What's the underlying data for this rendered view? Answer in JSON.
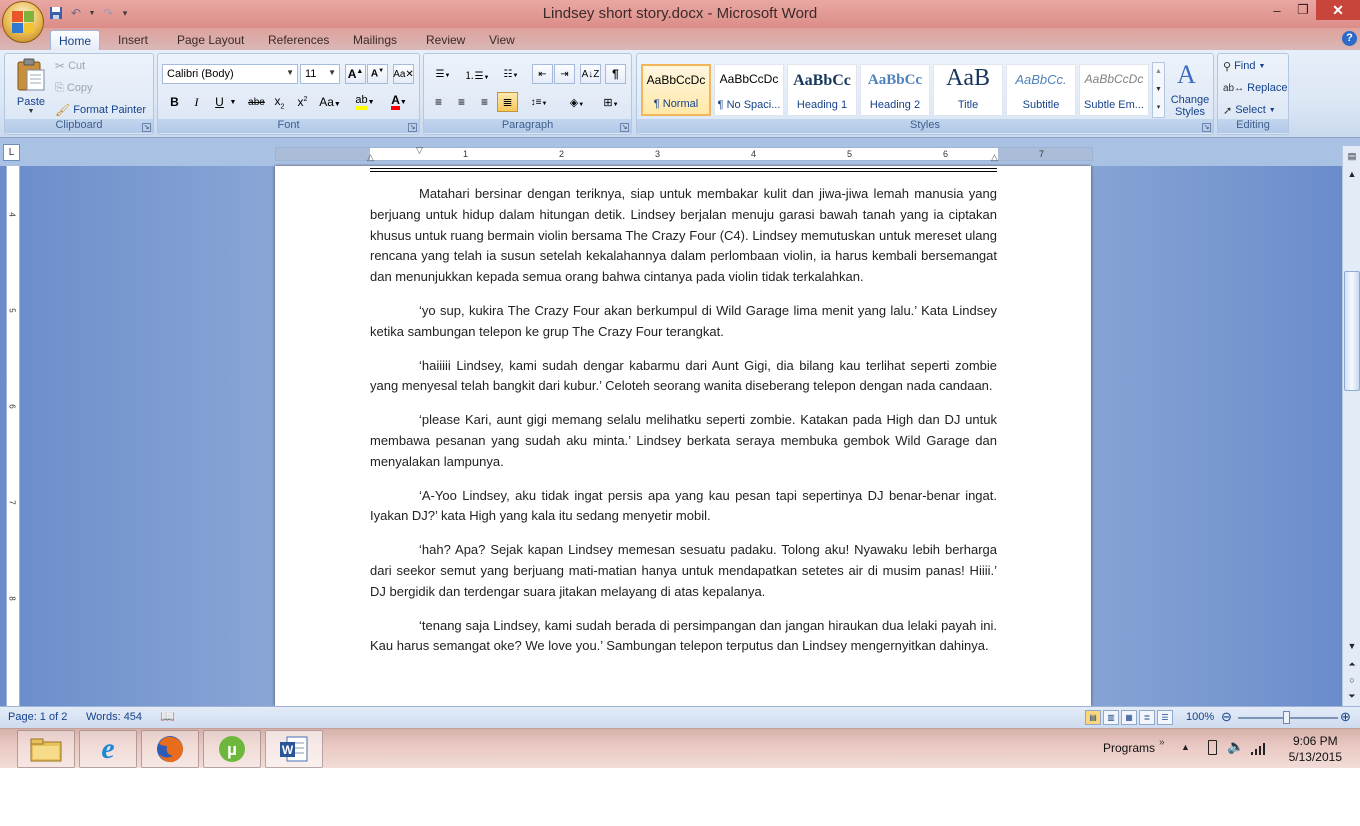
{
  "window": {
    "title": "Lindsey short story.docx - Microsoft Word",
    "minimize": "–",
    "restore": "❐",
    "close": "✕"
  },
  "quick_access": [
    "save-icon",
    "undo-icon",
    "redo-icon",
    "customize-icon"
  ],
  "tabs": [
    "Home",
    "Insert",
    "Page Layout",
    "References",
    "Mailings",
    "Review",
    "View"
  ],
  "active_tab": "Home",
  "ribbon": {
    "clipboard": {
      "label": "Clipboard",
      "paste": "Paste",
      "cut": "Cut",
      "copy": "Copy",
      "format_painter": "Format Painter"
    },
    "font": {
      "label": "Font",
      "font_name": "Calibri (Body)",
      "font_size": "11"
    },
    "paragraph": {
      "label": "Paragraph"
    },
    "styles": {
      "label": "Styles",
      "tiles": [
        {
          "preview": "AaBbCcDc",
          "name": "¶ Normal"
        },
        {
          "preview": "AaBbCcDc",
          "name": "¶ No Spaci..."
        },
        {
          "preview": "AaBbCc",
          "name": "Heading 1"
        },
        {
          "preview": "AaBbCc",
          "name": "Heading 2"
        },
        {
          "preview": "AaB",
          "name": "Title"
        },
        {
          "preview": "AaBbCc.",
          "name": "Subtitle"
        },
        {
          "preview": "AaBbCcDc",
          "name": "Subtle Em..."
        }
      ],
      "change_styles": "Change Styles"
    },
    "editing": {
      "label": "Editing",
      "find": "Find",
      "replace": "Replace",
      "select": "Select"
    }
  },
  "ruler": {
    "numbers": [
      "1",
      "1",
      "2",
      "3",
      "4",
      "5",
      "6",
      "7"
    ]
  },
  "vruler": {
    "numbers": [
      "4",
      "5",
      "6",
      "7",
      "8"
    ]
  },
  "document": {
    "paragraphs": [
      "Matahari bersinar dengan teriknya, siap untuk membakar kulit dan jiwa-jiwa lemah manusia yang berjuang untuk hidup dalam hitungan detik. Lindsey berjalan menuju garasi bawah tanah yang ia ciptakan khusus untuk ruang bermain violin bersama The Crazy Four (C4). Lindsey memutuskan untuk mereset ulang rencana yang telah ia susun setelah kekalahannya dalam perlombaan violin, ia harus kembali bersemangat dan menunjukkan kepada semua orang bahwa cintanya pada violin tidak terkalahkan.",
      "‘yo sup, kukira The Crazy Four akan berkumpul di Wild Garage lima menit yang lalu.’ Kata Lindsey ketika sambungan telepon ke grup The Crazy Four terangkat.",
      "‘haiiiii Lindsey, kami sudah dengar kabarmu dari Aunt Gigi, dia bilang kau terlihat seperti zombie yang menyesal telah bangkit dari kubur.’ Celoteh seorang wanita diseberang telepon dengan nada candaan.",
      "‘please Kari, aunt gigi memang selalu melihatku seperti zombie. Katakan pada High dan DJ untuk membawa pesanan yang sudah aku minta.’ Lindsey berkata seraya membuka gembok Wild Garage dan menyalakan lampunya.",
      "‘A-Yoo Lindsey, aku tidak ingat persis apa yang kau pesan tapi sepertinya DJ benar-benar ingat. Iyakan DJ?’ kata High yang kala itu sedang menyetir mobil.",
      "‘hah? Apa? Sejak kapan Lindsey memesan sesuatu padaku. Tolong aku! Nyawaku lebih berharga dari seekor semut yang berjuang mati-matian hanya untuk mendapatkan setetes air di musim panas! Hiiii.’ DJ bergidik dan terdengar suara jitakan melayang di atas kepalanya.",
      "‘tenang saja Lindsey, kami sudah berada di persimpangan dan jangan hiraukan dua lelaki payah ini. Kau harus semangat oke? We love you.’ Sambungan telepon terputus dan Lindsey mengernyitkan dahinya."
    ]
  },
  "status": {
    "page": "Page: 1 of 2",
    "words": "Words: 454",
    "zoom": "100%"
  },
  "taskbar": {
    "apps": [
      "folder-icon",
      "internet-explorer-icon",
      "firefox-icon",
      "utorrent-icon",
      "word-icon"
    ],
    "programs": "Programs",
    "time": "9:06 PM",
    "date": "5/13/2015"
  }
}
